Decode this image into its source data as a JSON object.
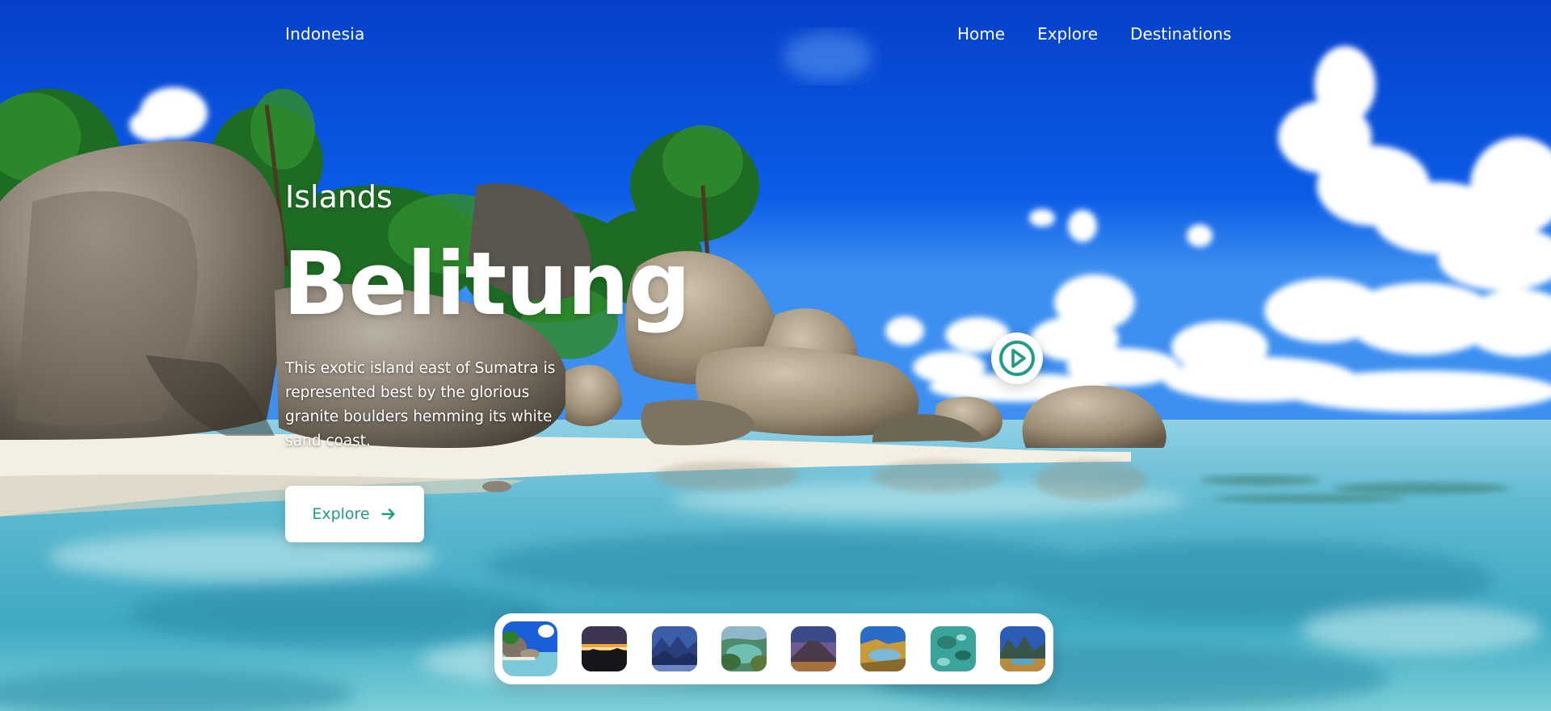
{
  "header": {
    "brand": "Indonesia",
    "nav": [
      "Home",
      "Explore",
      "Destinations"
    ]
  },
  "hero": {
    "category": "Islands",
    "title": "Belitung",
    "description": "This exotic island east of Sumatra is represented best by the glorious granite boulders hemming its white sand coast.",
    "cta_label": "Explore",
    "cta_icon": "arrow-right-icon"
  },
  "play_button": {
    "icon": "play-circle-icon"
  },
  "thumbnails": [
    {
      "name": "beach-boulders",
      "active": true
    },
    {
      "name": "sunset-silhouette",
      "active": false
    },
    {
      "name": "blue-mountains",
      "active": false
    },
    {
      "name": "green-lagoon",
      "active": false
    },
    {
      "name": "purple-volcano",
      "active": false
    },
    {
      "name": "golden-bay",
      "active": false
    },
    {
      "name": "turquoise-reef",
      "active": false
    },
    {
      "name": "island-peaks",
      "active": false
    }
  ],
  "colors": {
    "accent": "#1f9b86",
    "sky": "#0a53d9",
    "water": "#6ec6d8",
    "text": "#ffffff"
  }
}
